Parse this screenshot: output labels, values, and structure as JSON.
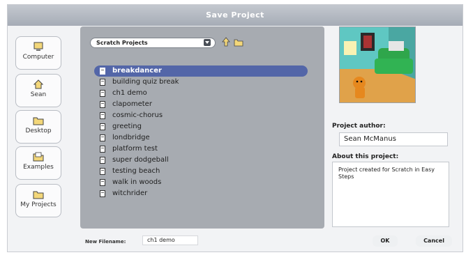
{
  "dialog": {
    "title": "Save Project"
  },
  "sidebar": {
    "items": [
      {
        "label": "Computer"
      },
      {
        "label": "Sean"
      },
      {
        "label": "Desktop"
      },
      {
        "label": "Examples"
      },
      {
        "label": "My Projects"
      }
    ]
  },
  "browser": {
    "location": "Scratch Projects",
    "files": [
      {
        "name": "breakdancer",
        "selected": true
      },
      {
        "name": "building quiz break"
      },
      {
        "name": "ch1 demo"
      },
      {
        "name": "clapometer"
      },
      {
        "name": "cosmic-chorus"
      },
      {
        "name": "greeting"
      },
      {
        "name": "londbridge"
      },
      {
        "name": "platform test"
      },
      {
        "name": "super dodgeball"
      },
      {
        "name": "testing beach"
      },
      {
        "name": "walk in woods"
      },
      {
        "name": "witchrider"
      }
    ]
  },
  "details": {
    "author_label": "Project author:",
    "author": "Sean McManus",
    "about_label": "About this project:",
    "about": "Project created for Scratch in Easy Steps"
  },
  "footer": {
    "filename_label": "New Filename:",
    "filename": "ch1 demo",
    "ok_label": "OK",
    "cancel_label": "Cancel"
  },
  "colors": {
    "selection": "#5366a8",
    "panel": "#a7abb1",
    "titlebar": "#a6acb6"
  }
}
